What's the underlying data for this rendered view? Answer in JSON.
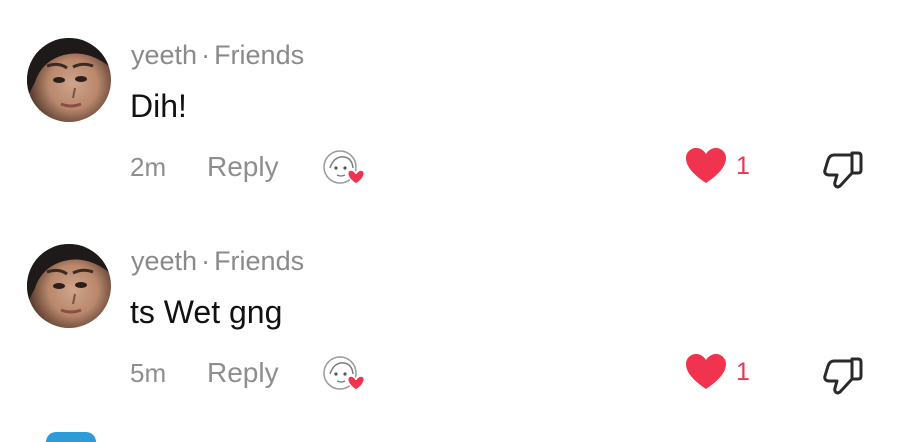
{
  "comments": [
    {
      "username": "yeeth",
      "separator": "·",
      "relation": "Friends",
      "text": "Dih!",
      "time": "2m",
      "reply_label": "Reply",
      "like_count": "1"
    },
    {
      "username": "yeeth",
      "separator": "·",
      "relation": "Friends",
      "text": "ts Wet gng",
      "time": "5m",
      "reply_label": "Reply",
      "like_count": "1"
    }
  ],
  "colors": {
    "like_red": "#f0334f",
    "muted_text": "#8e8e8e",
    "primary_text": "#111111"
  },
  "icons": {
    "avatar": "user-avatar",
    "creator_liked": "creator-liked-badge-icon",
    "like": "heart-icon",
    "dislike": "thumbs-down-icon"
  }
}
